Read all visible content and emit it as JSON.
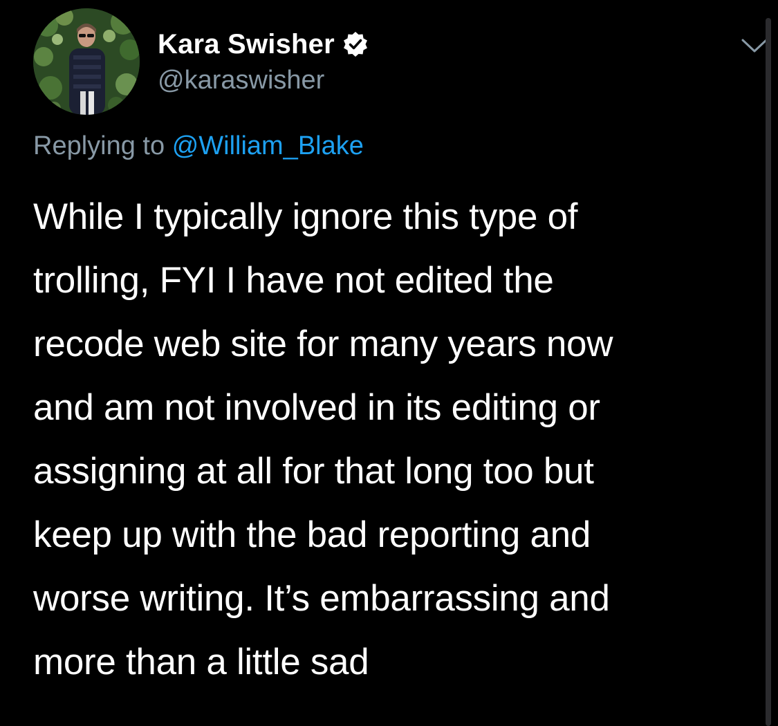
{
  "author": {
    "display_name": "Kara Swisher",
    "handle": "@karaswisher",
    "verified_icon": "verified-badge-icon",
    "avatar": "profile-photo"
  },
  "menu": {
    "icon": "chevron-down-icon"
  },
  "reply": {
    "prefix": "Replying to",
    "mention": "@William_Blake"
  },
  "tweet": {
    "lines": [
      "While I typically ignore this type of",
      "trolling, FYI I have not edited the",
      "recode web site for many years now",
      "and am not involved in its editing or",
      "assigning at all for that long too but",
      "keep up with the bad reporting and",
      "worse writing. It’s embarrassing and",
      "more than a little sad"
    ]
  },
  "colors": {
    "background": "#000000",
    "text": "#ffffff",
    "secondary_text": "#8899a6",
    "link": "#1da1f2"
  }
}
